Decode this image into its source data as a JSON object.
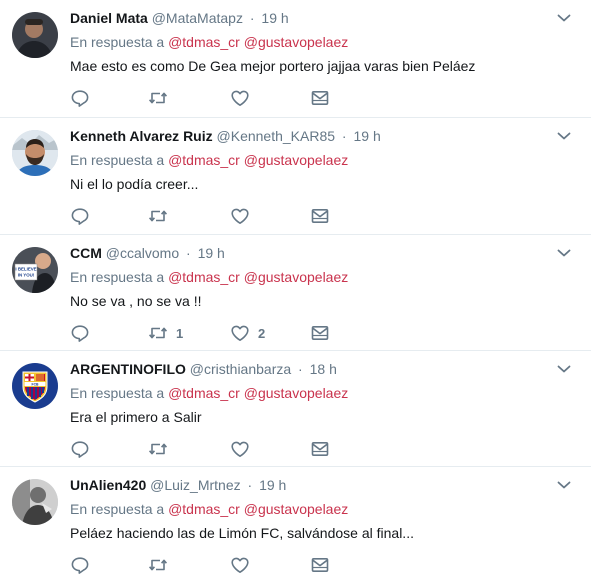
{
  "tweets": [
    {
      "fullname": "Daniel Mata",
      "username": "@MataMatapz",
      "separator": "·",
      "time": "19 h",
      "reply_prefix": "En respuesta a",
      "reply_mentions": [
        "@tdmas_cr",
        "@gustavopelaez"
      ],
      "text": "Mae esto es como De  Gea mejor portero jajjaa varas bien Peláez",
      "retweets": "",
      "likes": "",
      "avatar": "avatar-person-dark"
    },
    {
      "fullname": "Kenneth Alvarez Ruiz",
      "username": "@Kenneth_KAR85",
      "separator": "·",
      "time": "19 h",
      "reply_prefix": "En respuesta a",
      "reply_mentions": [
        "@tdmas_cr",
        "@gustavopelaez"
      ],
      "text": "Ni el lo podía creer...",
      "retweets": "",
      "likes": "",
      "avatar": "avatar-person-bearded"
    },
    {
      "fullname": "CCM",
      "username": "@ccalvomo",
      "separator": "·",
      "time": "19 h",
      "reply_prefix": "En respuesta a",
      "reply_mentions": [
        "@tdmas_cr",
        "@gustavopelaez"
      ],
      "text": "No se va , no se va !!",
      "retweets": "1",
      "likes": "2",
      "avatar": "avatar-person-sign",
      "avatar_sign_text": "I BELIEVE IN YOU!"
    },
    {
      "fullname": "ARGENTINOFILO",
      "username": "@cristhianbarza",
      "separator": "·",
      "time": "18 h",
      "reply_prefix": "En respuesta a",
      "reply_mentions": [
        "@tdmas_cr",
        "@gustavopelaez"
      ],
      "text": "Era el primero a Salir",
      "retweets": "",
      "likes": "",
      "avatar": "avatar-fc-barcelona-crest",
      "avatar_crest_text": "FCB"
    },
    {
      "fullname": "UnAlien420",
      "username": "@Luiz_Mrtnez",
      "separator": "·",
      "time": "19 h",
      "reply_prefix": "En respuesta a",
      "reply_mentions": [
        "@tdmas_cr",
        "@gustavopelaez"
      ],
      "text": "Peláez haciendo las de Limón FC, salvándose al final...",
      "retweets": "",
      "likes": "",
      "avatar": "avatar-bw-photo"
    }
  ],
  "colors": {
    "mention": "#c9334d",
    "secondary_text": "#657786",
    "primary_text": "#14171a",
    "divider": "#e6ecf0"
  },
  "icons": {
    "reply": "reply-icon",
    "retweet": "retweet-icon",
    "like": "heart-icon",
    "dm": "envelope-icon",
    "more": "chevron-down-icon"
  }
}
